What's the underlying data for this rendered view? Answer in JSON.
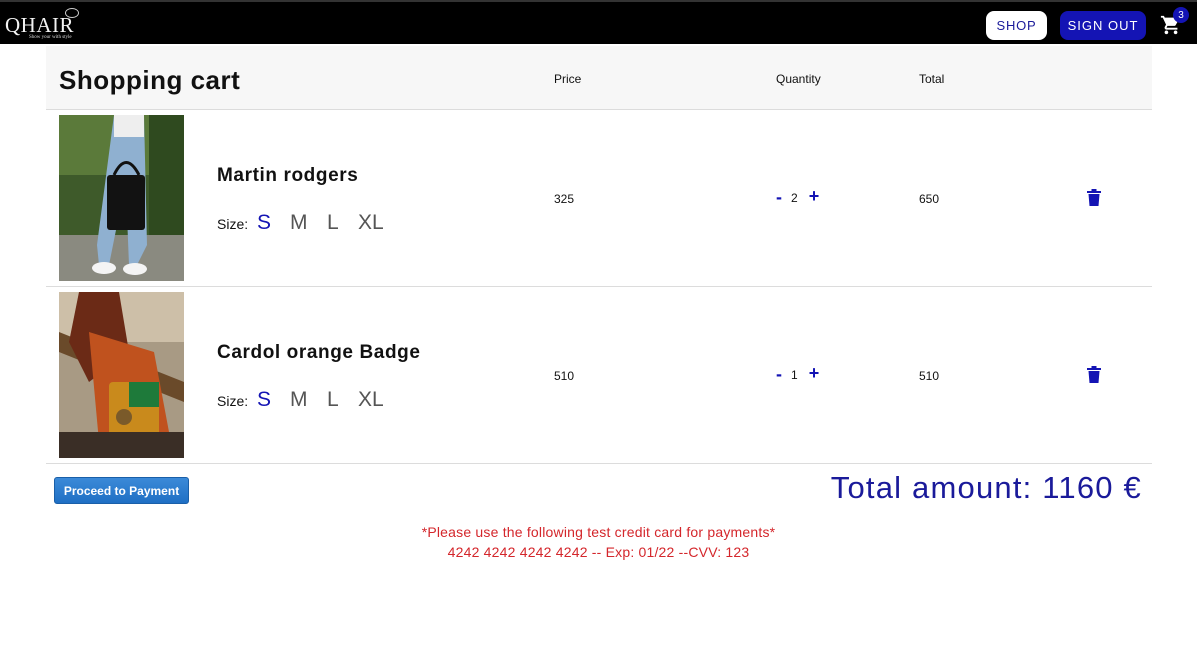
{
  "header": {
    "logo_text": "QHAIR",
    "logo_tagline": "Show your with style",
    "shop_label": "SHOP",
    "signout_label": "SIGN OUT",
    "cart_count": "3"
  },
  "cart": {
    "title": "Shopping cart",
    "columns": {
      "price": "Price",
      "quantity": "Quantity",
      "total": "Total"
    },
    "size_label": "Size:",
    "sizes": [
      "S",
      "M",
      "L",
      "XL"
    ],
    "items": [
      {
        "name": "Martin rodgers",
        "selected_size": "S",
        "price": "325",
        "quantity": "2",
        "total": "650",
        "image": "black tote bag photo"
      },
      {
        "name": "Cardol orange Badge",
        "selected_size": "S",
        "price": "510",
        "quantity": "1",
        "total": "510",
        "image": "orange handbag photo"
      }
    ],
    "minus": "-",
    "plus": "+"
  },
  "footer": {
    "proceed_label": "Proceed to Payment",
    "total_amount": "Total amount: 1160 €",
    "note_line1": "*Please use the following test credit card for payments*",
    "note_line2": "4242 4242 4242 4242 -- Exp: 01/22 --CVV: 123"
  },
  "colors": {
    "accent": "#1414b4",
    "note": "#d4262b",
    "topbar": "#000000"
  }
}
